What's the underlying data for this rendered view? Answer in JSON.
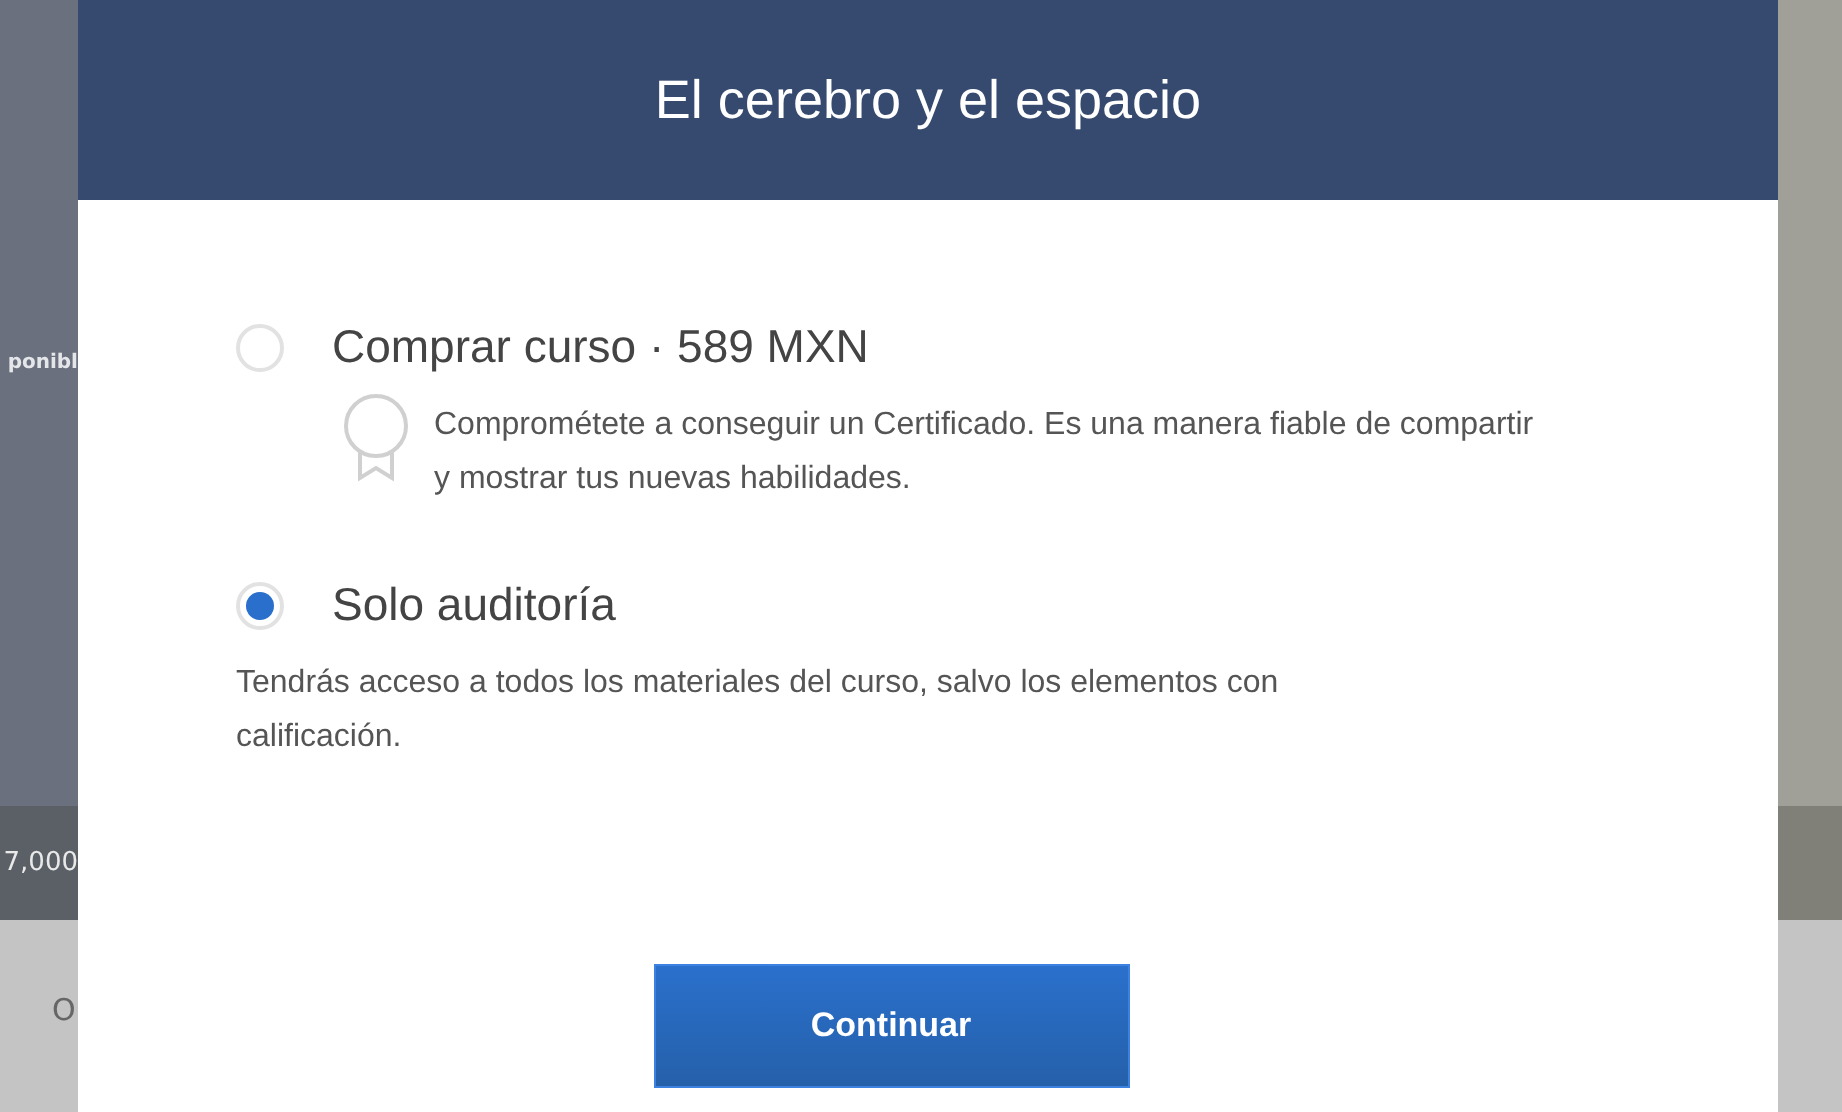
{
  "backdrop": {
    "left_texts": [
      "ponibl",
      "7,000",
      "O"
    ]
  },
  "dialog": {
    "title": "El cerebro y el espacio",
    "options": [
      {
        "kind": "certificate",
        "selected": false,
        "title": "Comprar curso · 589 MXN",
        "description": "Comprométete a conseguir un Certificado. Es una manera fiable de compartir y mostrar tus nuevas habilidades."
      },
      {
        "kind": "plain",
        "selected": true,
        "title": "Solo auditoría",
        "description": "Tendrás acceso a todos los materiales del curso, salvo los elementos con calificación."
      }
    ],
    "button": "Continuar"
  }
}
